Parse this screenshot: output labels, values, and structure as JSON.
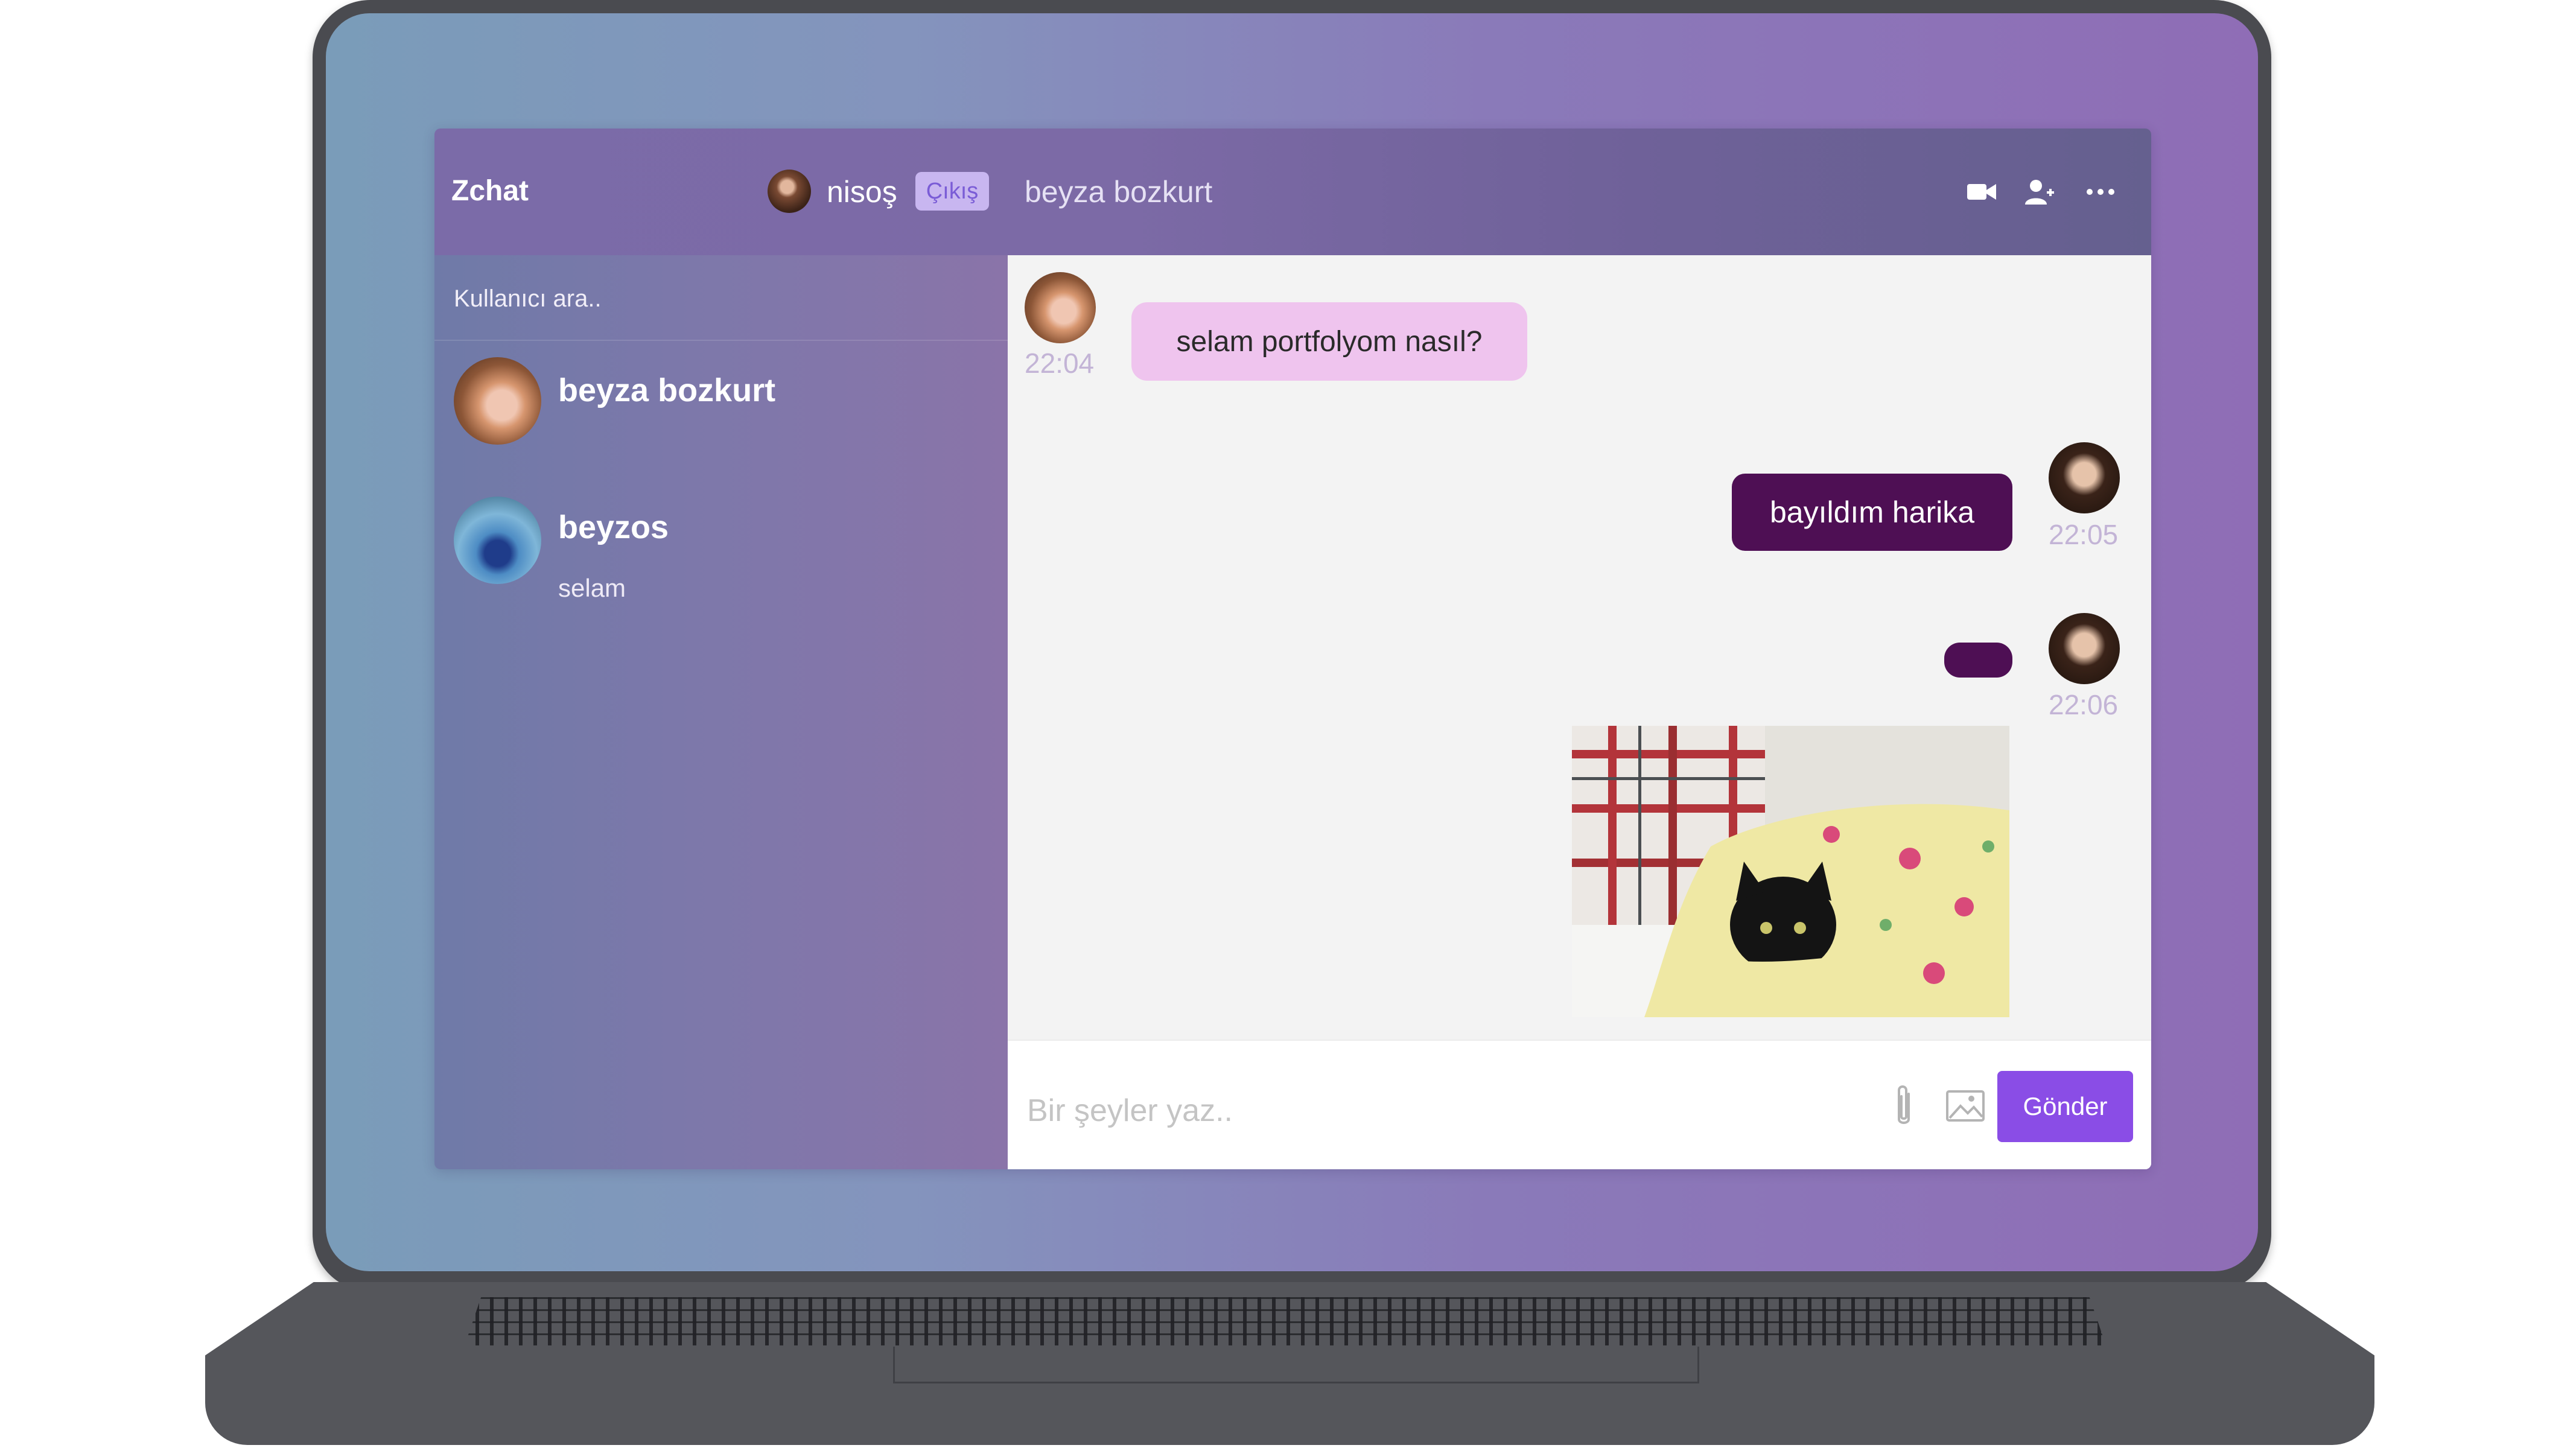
{
  "header": {
    "brand": "Zchat",
    "user_name": "nisoş",
    "logout_label": "Çıkış",
    "chat_title": "beyza bozkurt",
    "icons": [
      "video-icon",
      "add-user-icon",
      "more-icon"
    ]
  },
  "sidebar": {
    "search_placeholder": "Kullanıcı ara..",
    "contacts": [
      {
        "name": "beyza bozkurt",
        "last_message": ""
      },
      {
        "name": "beyzos",
        "last_message": "selam"
      }
    ]
  },
  "messages": [
    {
      "direction": "incoming",
      "text": "selam portfolyom nasıl?",
      "time": "22:04"
    },
    {
      "direction": "outgoing",
      "text": "bayıldım harika",
      "time": "22:05"
    },
    {
      "direction": "outgoing",
      "text": "",
      "time": "22:06",
      "has_image": true
    }
  ],
  "composer": {
    "placeholder": "Bir şeyler yaz..",
    "send_label": "Gönder"
  },
  "colors": {
    "accent": "#8a4de6",
    "outgoing_bubble": "#4e0f54",
    "incoming_bubble": "#efc4ee"
  }
}
